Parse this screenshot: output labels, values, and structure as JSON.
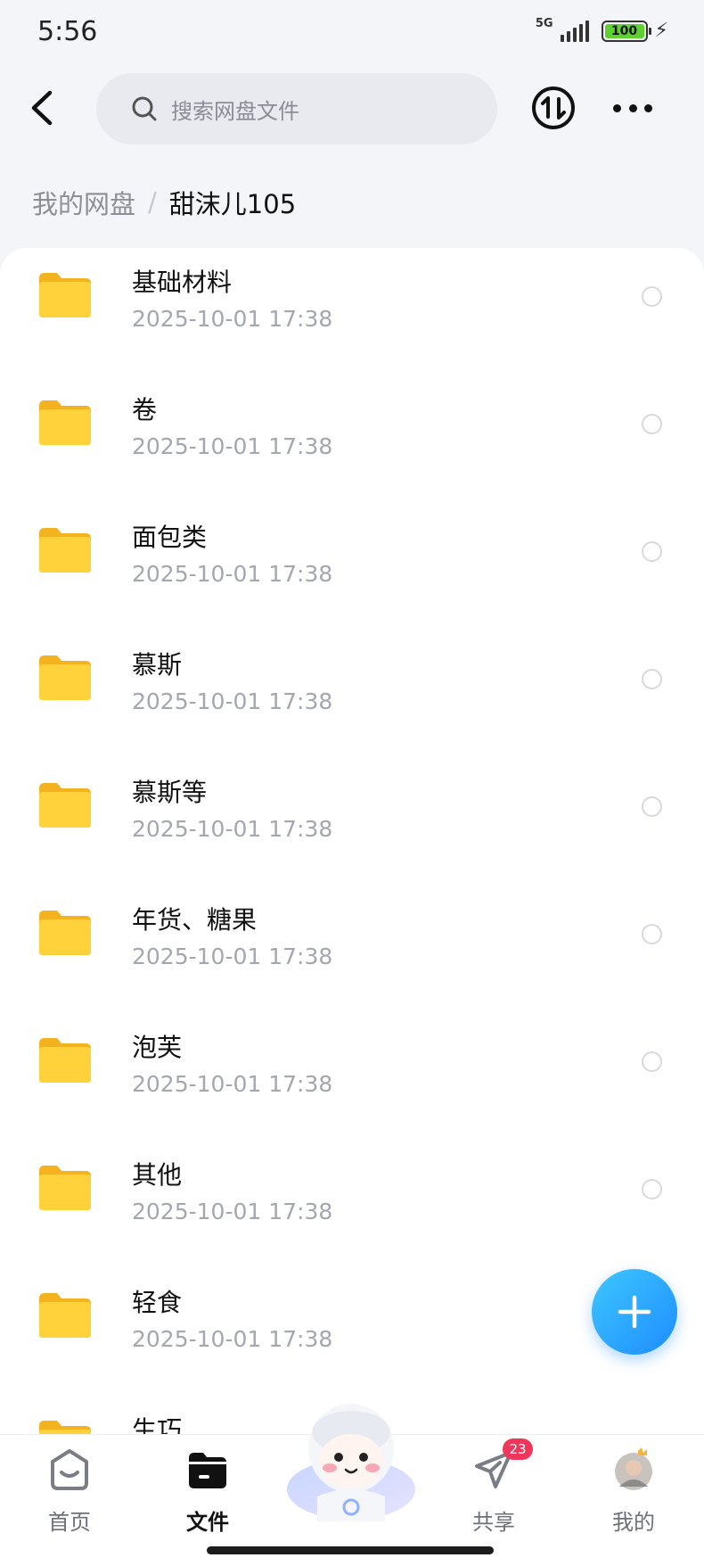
{
  "status_bar": {
    "time": "5:56",
    "network": "5G",
    "battery": "100"
  },
  "search": {
    "placeholder": "搜索网盘文件"
  },
  "breadcrumb": {
    "root": "我的网盘",
    "separator": "/",
    "current": "甜沫儿105"
  },
  "files": [
    {
      "name": "基础材料",
      "date": "2025-10-01  17:38",
      "icon": "folder-icon"
    },
    {
      "name": "卷",
      "date": "2025-10-01  17:38",
      "icon": "folder-icon"
    },
    {
      "name": "面包类",
      "date": "2025-10-01  17:38",
      "icon": "folder-icon"
    },
    {
      "name": "慕斯",
      "date": "2025-10-01  17:38",
      "icon": "folder-icon"
    },
    {
      "name": "慕斯等",
      "date": "2025-10-01  17:38",
      "icon": "folder-icon"
    },
    {
      "name": "年货、糖果",
      "date": "2025-10-01  17:38",
      "icon": "folder-icon"
    },
    {
      "name": "泡芙",
      "date": "2025-10-01  17:38",
      "icon": "folder-icon"
    },
    {
      "name": "其他",
      "date": "2025-10-01  17:38",
      "icon": "folder-icon"
    },
    {
      "name": "轻食",
      "date": "2025-10-01  17:38",
      "icon": "folder-icon"
    },
    {
      "name": "生巧",
      "date": "",
      "icon": "folder-icon"
    }
  ],
  "bottom_nav": {
    "items": [
      {
        "label": "首页",
        "icon": "home-icon",
        "active": false
      },
      {
        "label": "文件",
        "icon": "folder-icon",
        "active": true
      },
      {
        "label": "",
        "icon": "mascot-icon",
        "active": false
      },
      {
        "label": "共享",
        "icon": "share-icon",
        "active": false,
        "badge": "23"
      },
      {
        "label": "我的",
        "icon": "avatar",
        "active": false
      }
    ]
  },
  "colors": {
    "accent": "#1e8cff",
    "folder": "#ffc934",
    "badge": "#f0365a"
  }
}
